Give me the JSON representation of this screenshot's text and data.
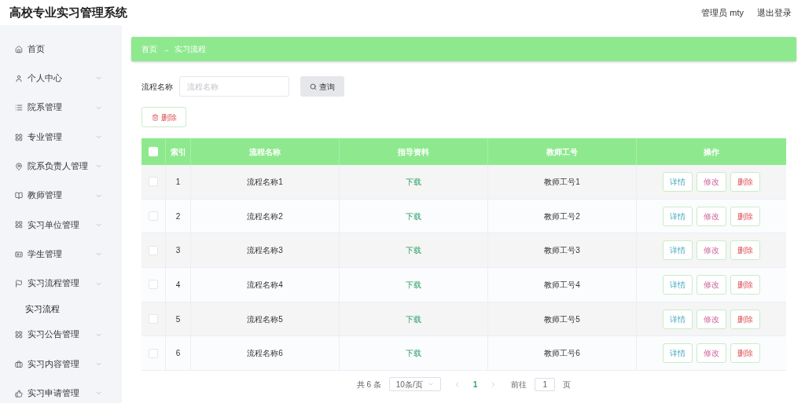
{
  "header": {
    "title": "高校专业实习管理系统",
    "user": "管理员 mty",
    "logout": "退出登录"
  },
  "sidebar": {
    "items": [
      {
        "label": "首页",
        "kind": "link"
      },
      {
        "label": "个人中心",
        "kind": "menu"
      },
      {
        "label": "院系管理",
        "kind": "menu"
      },
      {
        "label": "专业管理",
        "kind": "menu"
      },
      {
        "label": "院系负责人管理",
        "kind": "menu"
      },
      {
        "label": "教师管理",
        "kind": "menu"
      },
      {
        "label": "实习单位管理",
        "kind": "menu"
      },
      {
        "label": "学生管理",
        "kind": "menu"
      },
      {
        "label": "实习流程管理",
        "kind": "menu",
        "children": [
          {
            "label": "实习流程"
          }
        ]
      },
      {
        "label": "实习公告管理",
        "kind": "menu"
      },
      {
        "label": "实习内容管理",
        "kind": "menu"
      },
      {
        "label": "实习申请管理",
        "kind": "menu"
      }
    ]
  },
  "breadcrumb": [
    "首页",
    "→",
    "实习流程"
  ],
  "search": {
    "label": "流程名称",
    "placeholder": "流程名称",
    "button": "查询"
  },
  "delete_button": "删除",
  "table": {
    "select_all": {
      "checked": false
    },
    "columns": [
      "索引",
      "流程名称",
      "指导资料",
      "教师工号",
      "操作"
    ],
    "rows": [
      {
        "checked": false,
        "index": "1",
        "name": "流程名称1",
        "material": "下载",
        "teacher": "教师工号1",
        "actions": [
          "详情",
          "修改",
          "删除"
        ]
      },
      {
        "checked": false,
        "index": "2",
        "name": "流程名称2",
        "material": "下载",
        "teacher": "教师工号2",
        "actions": [
          "详情",
          "修改",
          "删除"
        ]
      },
      {
        "checked": false,
        "index": "3",
        "name": "流程名称3",
        "material": "下载",
        "teacher": "教师工号3",
        "actions": [
          "详情",
          "修改",
          "删除"
        ]
      },
      {
        "checked": false,
        "index": "4",
        "name": "流程名称4",
        "material": "下载",
        "teacher": "教师工号4",
        "actions": [
          "详情",
          "修改",
          "删除"
        ]
      },
      {
        "checked": false,
        "index": "5",
        "name": "流程名称5",
        "material": "下载",
        "teacher": "教师工号5",
        "actions": [
          "详情",
          "修改",
          "删除"
        ]
      },
      {
        "checked": false,
        "index": "6",
        "name": "流程名称6",
        "material": "下载",
        "teacher": "教师工号6",
        "actions": [
          "详情",
          "修改",
          "删除"
        ]
      }
    ]
  },
  "pagination": {
    "total": "共 6 条",
    "page_size": "10条/页",
    "pages": [
      {
        "label": "1",
        "selected": true
      }
    ],
    "goto_label": "前往",
    "goto_value": "1",
    "goto_suffix": "页"
  }
}
